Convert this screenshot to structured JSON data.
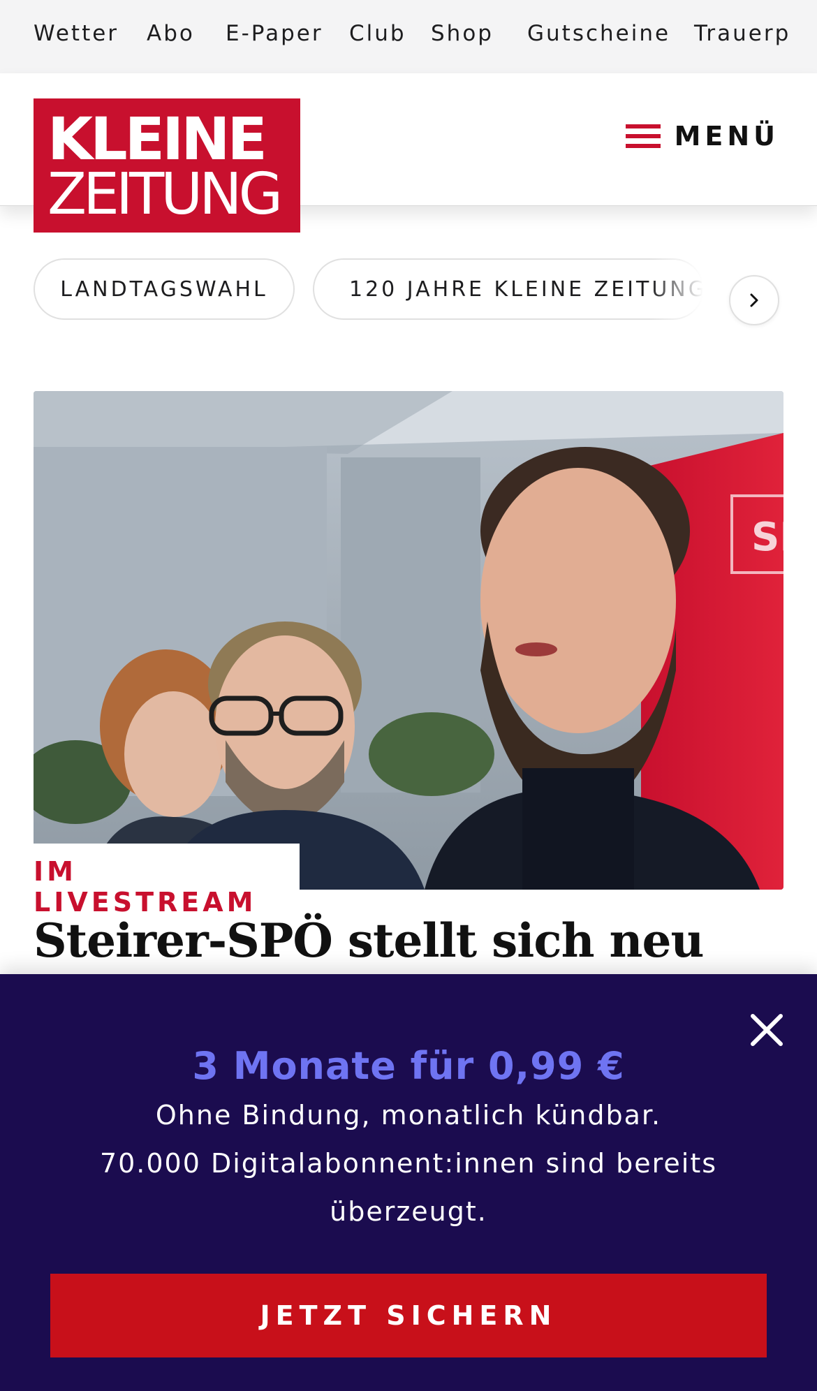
{
  "topnav": {
    "items": [
      "Wetter",
      "Abo",
      "E-Paper",
      "Club",
      "Shop",
      "Gutscheine",
      "Trauerp"
    ]
  },
  "header": {
    "logo": {
      "line1": "KLEINE",
      "line2": "ZEITUNG"
    },
    "menu_label": "MENÜ"
  },
  "topics": {
    "items": [
      "LANDTAGSWAHL",
      "120 JAHRE KLEINE ZEITUNG"
    ]
  },
  "article": {
    "kicker": "IM LIVESTREAM",
    "headline": "Steirer-SPÖ stellt sich neu",
    "banner_text": "SP"
  },
  "promo": {
    "title": "3 Monate für 0,99 €",
    "line1": "Ohne Bindung, monatlich kündbar.",
    "line2": "70.000 Digitalabonnent:innen sind bereits",
    "line3": "überzeugt.",
    "cta_label": "JETZT SICHERN"
  },
  "colors": {
    "brand_red": "#c8102e",
    "overlay_bg": "#1b0c4f",
    "promo_accent": "#6f74f2"
  }
}
